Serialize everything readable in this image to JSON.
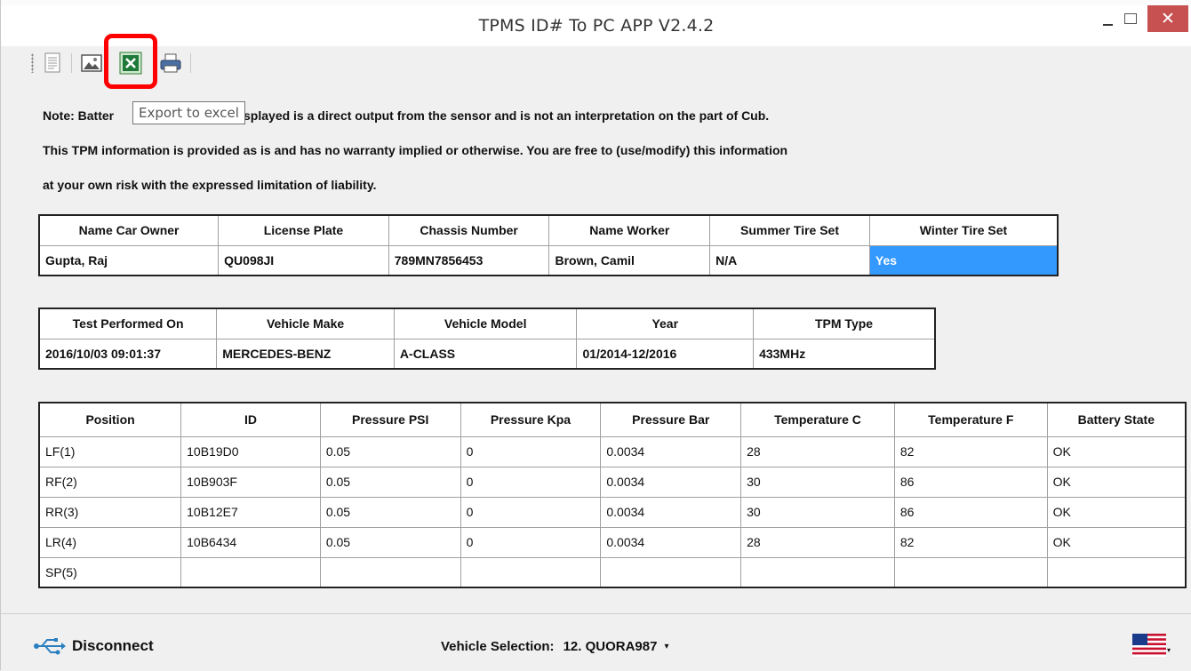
{
  "window": {
    "title": "TPMS ID# To PC APP V2.4.2",
    "close_glyph": "✕"
  },
  "toolbar": {
    "tools": [
      {
        "icon": "document-icon"
      },
      {
        "icon": "image-icon"
      },
      {
        "icon": "excel-icon"
      },
      {
        "icon": "printer-icon"
      }
    ],
    "tooltip": "Export to excel"
  },
  "notes": {
    "line1_start": "Note: Batter",
    "line1_end": "isplayed is a direct output from the sensor and is not an interpretation on the part of Cub.",
    "line2": "This TPM information is provided as is and has no warranty implied or otherwise. You are free to (use/modify) this information",
    "line3": "at your own risk with the expressed limitation of liability."
  },
  "owner_table": {
    "headers": [
      "Name Car Owner",
      "License Plate",
      "Chassis Number",
      "Name Worker",
      "Summer Tire Set",
      "Winter Tire Set"
    ],
    "values": [
      "Gupta, Raj",
      "QU098JI",
      "789MN7856453",
      "Brown, Camil",
      "N/A",
      "Yes"
    ]
  },
  "vehicle_table": {
    "headers": [
      "Test Performed On",
      "Vehicle Make",
      "Vehicle Model",
      "Year",
      "TPM Type"
    ],
    "values": [
      "2016/10/03  09:01:37",
      "MERCEDES-BENZ",
      "A-CLASS",
      "01/2014-12/2016",
      "433MHz"
    ]
  },
  "sensor_table": {
    "headers": [
      "Position",
      "ID",
      "Pressure PSI",
      "Pressure Kpa",
      "Pressure Bar",
      "Temperature C",
      "Temperature F",
      "Battery State"
    ],
    "rows": [
      [
        "LF(1)",
        "10B19D0",
        "0.05",
        "0",
        "0.0034",
        "28",
        "82",
        "OK"
      ],
      [
        "RF(2)",
        "10B903F",
        "0.05",
        "0",
        "0.0034",
        "30",
        "86",
        "OK"
      ],
      [
        "RR(3)",
        "10B12E7",
        "0.05",
        "0",
        "0.0034",
        "30",
        "86",
        "OK"
      ],
      [
        "LR(4)",
        "10B6434",
        "0.05",
        "0",
        "0.0034",
        "28",
        "82",
        "OK"
      ],
      [
        "SP(5)",
        "",
        "",
        "",
        "",
        "",
        "",
        ""
      ]
    ]
  },
  "statusbar": {
    "disconnect_label": "Disconnect",
    "vehicle_selection_label": "Vehicle Selection:",
    "vehicle_selection_value": "12. QUORA987",
    "caret": "▾",
    "language_icon": "us-flag-icon"
  },
  "colors": {
    "highlight": "#ff0000",
    "selected_cell": "#3399ff",
    "close_button": "#c75050"
  }
}
